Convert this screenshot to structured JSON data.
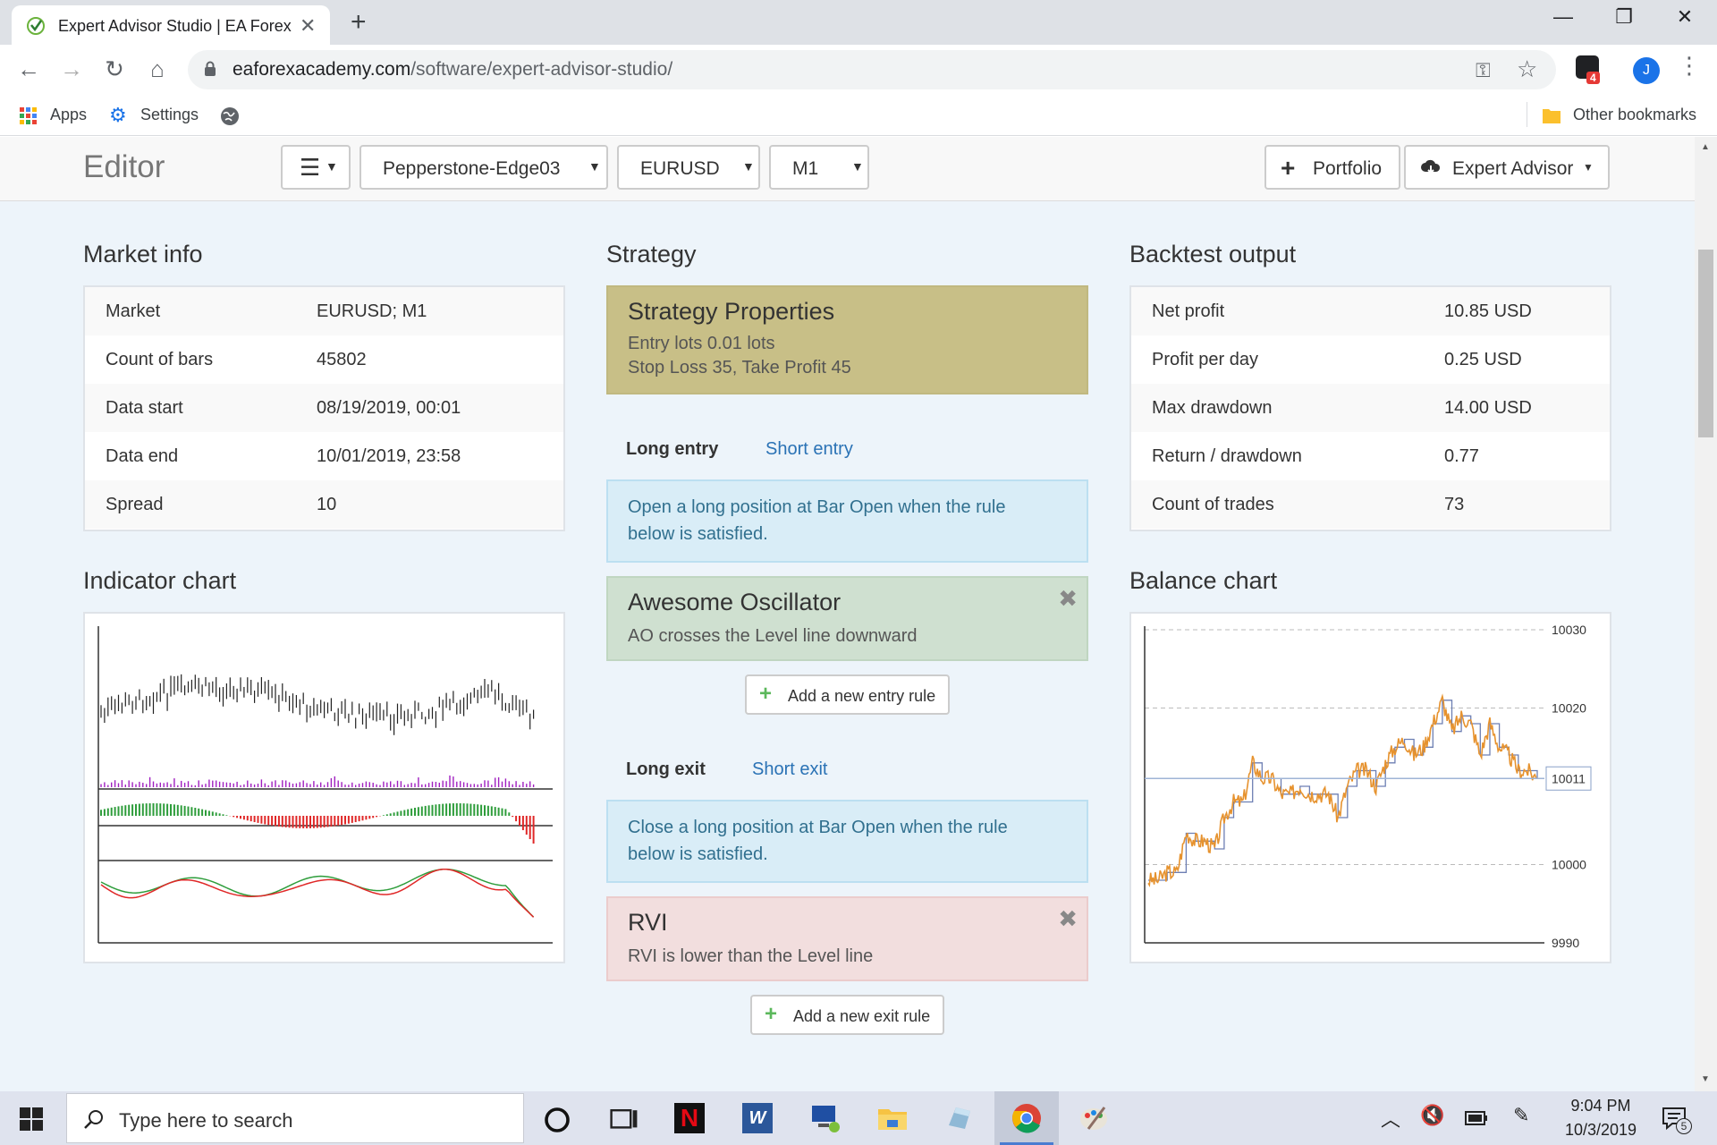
{
  "browser": {
    "tab_title": "Expert Advisor Studio | EA Forex Academy",
    "url_host": "eaforexacademy.com",
    "url_path": "/software/expert-advisor-studio/",
    "profile_initial": "J",
    "extension_badge": "4",
    "bookmarks": [
      {
        "label": "Apps",
        "icon": "apps-grid-icon"
      },
      {
        "label": "Settings",
        "icon": "gear-icon"
      },
      {
        "label": "",
        "icon": "globe-icon"
      }
    ],
    "other_bookmarks": "Other bookmarks"
  },
  "navbar": {
    "title": "Editor",
    "menu_icon": "hamburger-icon",
    "server": "Pepperstone-Edge03",
    "symbol": "EURUSD",
    "timeframe": "M1",
    "portfolio_label": "Portfolio",
    "expert_advisor_label": "Expert Advisor"
  },
  "market_info": {
    "title": "Market info",
    "rows": [
      {
        "label": "Market",
        "value": "EURUSD; M1"
      },
      {
        "label": "Count of bars",
        "value": "45802"
      },
      {
        "label": "Data start",
        "value": "08/19/2019, 00:01"
      },
      {
        "label": "Data end",
        "value": "10/01/2019, 23:58"
      },
      {
        "label": "Spread",
        "value": "10"
      }
    ]
  },
  "strategy": {
    "title": "Strategy",
    "properties": {
      "heading": "Strategy Properties",
      "line1": "Entry lots 0.01 lots",
      "line2": "Stop Loss 35, Take Profit 45"
    },
    "entry_tabs": {
      "active": "Long entry",
      "inactive": "Short entry"
    },
    "entry_info": {
      "line1": "Open a long position at Bar Open when the rule",
      "line2": "below is satisfied."
    },
    "entry_rule": {
      "heading": "Awesome Oscillator",
      "desc": "AO crosses the Level line downward"
    },
    "add_entry_label": "Add a new entry rule",
    "exit_tabs": {
      "active": "Long exit",
      "inactive": "Short exit"
    },
    "exit_info": {
      "line1": "Close a long position at Bar Open when the rule",
      "line2": "below is satisfied."
    },
    "exit_rule": {
      "heading": "RVI",
      "desc": "RVI is lower than the Level line"
    },
    "add_exit_label": "Add a new exit rule",
    "colors": {
      "properties": "#c8bf87",
      "info": "#d9edf7",
      "entry_rule": "#cfe0d0",
      "exit_rule": "#f2dede",
      "link": "#2a72b5"
    }
  },
  "backtest": {
    "title": "Backtest output",
    "rows": [
      {
        "label": "Net profit",
        "value": "10.85 USD"
      },
      {
        "label": "Profit per day",
        "value": "0.25 USD"
      },
      {
        "label": "Max drawdown",
        "value": "14.00 USD"
      },
      {
        "label": "Return / drawdown",
        "value": "0.77"
      },
      {
        "label": "Count of trades",
        "value": "73"
      }
    ]
  },
  "indicator_chart": {
    "title": "Indicator chart"
  },
  "chart_data": {
    "type": "line",
    "title": "Balance chart",
    "xlabel": "",
    "ylabel": "",
    "y_ticks": [
      9990,
      10000,
      10020,
      10030
    ],
    "current_label": "10011",
    "ylim": [
      9990,
      10030
    ],
    "grid": true,
    "series": [
      {
        "values": [
          9998,
          9998,
          9999,
          9999,
          10004,
          10003,
          10003,
          10002,
          10006,
          10008,
          10008,
          10013,
          10011,
          10011,
          10009,
          10009,
          10010,
          10009,
          10009,
          10009,
          10006,
          10010,
          10012,
          10012,
          10010,
          10013,
          10015,
          10016,
          10014,
          10015,
          10018,
          10021,
          10017,
          10019,
          10018,
          10014,
          10018,
          10015,
          10014,
          10012,
          10012,
          10011
        ]
      }
    ],
    "colors": {
      "line": "#e6922e",
      "step": "#6d7fb3"
    }
  },
  "taskbar": {
    "search_placeholder": "Type here to search",
    "time": "9:04 PM",
    "date": "10/3/2019",
    "notification_count": "5"
  }
}
